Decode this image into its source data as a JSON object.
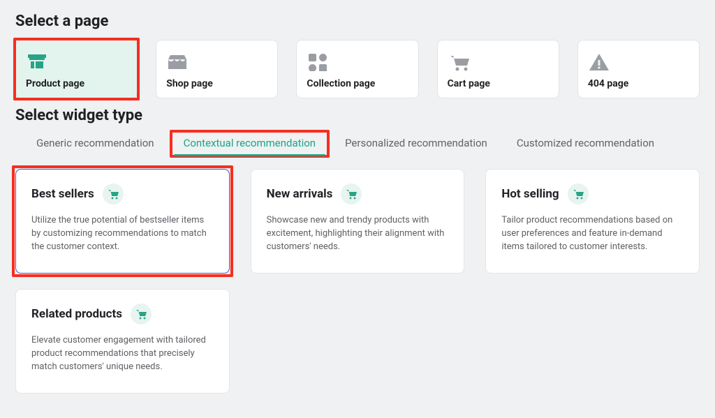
{
  "sections": {
    "select_page_title": "Select a page",
    "select_widget_title": "Select widget type"
  },
  "pages": [
    {
      "id": "product",
      "label": "Product page",
      "icon": "storefront-icon",
      "selected": true,
      "highlighted": true
    },
    {
      "id": "shop",
      "label": "Shop page",
      "icon": "shop-icon",
      "selected": false,
      "highlighted": false
    },
    {
      "id": "collection",
      "label": "Collection page",
      "icon": "grid-icon",
      "selected": false,
      "highlighted": false
    },
    {
      "id": "cart",
      "label": "Cart page",
      "icon": "cart-icon",
      "selected": false,
      "highlighted": false
    },
    {
      "id": "404",
      "label": "404 page",
      "icon": "warning-icon",
      "selected": false,
      "highlighted": false
    }
  ],
  "tabs": [
    {
      "id": "generic",
      "label": "Generic recommendation",
      "active": false,
      "highlighted": false
    },
    {
      "id": "contextual",
      "label": "Contextual recommendation",
      "active": true,
      "highlighted": true
    },
    {
      "id": "personalized",
      "label": "Personalized recommendation",
      "active": false,
      "highlighted": false
    },
    {
      "id": "customized",
      "label": "Customized recommendation",
      "active": false,
      "highlighted": false
    }
  ],
  "widgets": [
    {
      "id": "best-sellers",
      "title": "Best sellers",
      "desc": "Utilize the true potential of bestseller items by customizing recommendations to match the customer context.",
      "selected": true,
      "highlighted": true
    },
    {
      "id": "new-arrivals",
      "title": "New arrivals",
      "desc": "Showcase new and trendy products with excitement, highlighting their alignment with customers' needs.",
      "selected": false,
      "highlighted": false
    },
    {
      "id": "hot-selling",
      "title": "Hot selling",
      "desc": "Tailor product recommendations based on user preferences and feature in-demand items tailored to customer interests.",
      "selected": false,
      "highlighted": false
    },
    {
      "id": "related-products",
      "title": "Related products",
      "desc": "Elevate customer engagement with tailored product recommendations that precisely match customers' unique needs.",
      "selected": false,
      "highlighted": false
    }
  ],
  "colors": {
    "accent": "#1aa587",
    "highlight": "#f62e20",
    "select_border": "#2b5ed6"
  }
}
